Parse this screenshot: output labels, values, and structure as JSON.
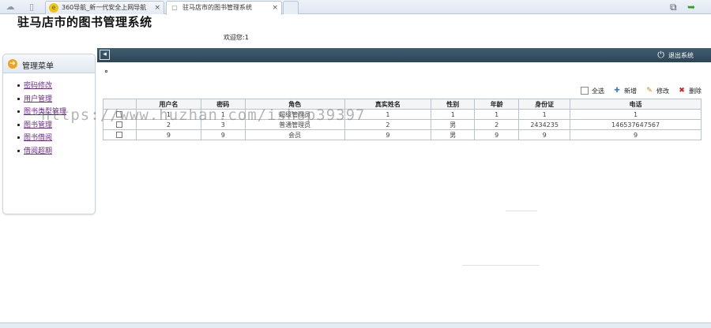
{
  "browser": {
    "tabs": [
      {
        "title": "360导航_新一代安全上网导航",
        "active": false
      },
      {
        "title": "驻马店市的图书管理系统",
        "active": true
      }
    ],
    "close_glyph": "×"
  },
  "header": {
    "site_title": "驻马店市的图书管理系统",
    "welcome_prefix": "欢迎您:",
    "welcome_user": "1"
  },
  "sidebar": {
    "title": "管理菜单",
    "items": [
      {
        "label": "密码修改"
      },
      {
        "label": "用户管理"
      },
      {
        "label": "图书类型管理"
      },
      {
        "label": "图书管理"
      },
      {
        "label": "图书借阅"
      },
      {
        "label": "借阅超期"
      }
    ]
  },
  "mainbar": {
    "logout_label": "退出系统"
  },
  "toolbar": {
    "select_all": "全选",
    "add": "新增",
    "edit": "修改",
    "delete": "删除"
  },
  "table": {
    "headers": [
      "",
      "用户名",
      "密码",
      "角色",
      "真实姓名",
      "性别",
      "年龄",
      "身份证",
      "电话"
    ],
    "rows": [
      [
        "",
        "1",
        "1",
        "超级管理员",
        "1",
        "1",
        "1",
        "1",
        "1"
      ],
      [
        "",
        "2",
        "3",
        "普通管理员",
        "2",
        "男",
        "2",
        "2434235",
        "146537647567"
      ],
      [
        "",
        "9",
        "9",
        "会员",
        "9",
        "男",
        "9",
        "9",
        "9"
      ]
    ]
  },
  "watermark": "https://www.huzhan.com/ishop39397",
  "icons": {
    "collapse": "collapse-icon",
    "power": "power-icon"
  }
}
